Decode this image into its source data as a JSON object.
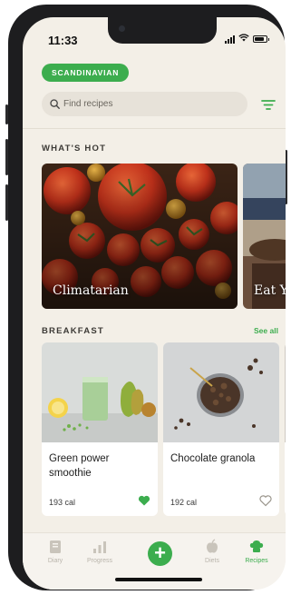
{
  "status": {
    "time": "11:33"
  },
  "header": {
    "region_pill": "SCANDINAVIAN"
  },
  "search": {
    "placeholder": "Find recipes"
  },
  "whats_hot": {
    "heading": "WHAT'S HOT",
    "cards": [
      {
        "label": "Climatarian"
      },
      {
        "label": "Eat Yo"
      }
    ]
  },
  "breakfast": {
    "heading": "BREAKFAST",
    "see_all": "See all",
    "cards": [
      {
        "title": "Green power smoothie",
        "calories": "193 cal",
        "favorited": true
      },
      {
        "title": "Chocolate granola",
        "calories": "192 cal",
        "favorited": false
      }
    ]
  },
  "tabbar": {
    "items": [
      {
        "label": "Diary",
        "icon": "diary-icon",
        "active": false
      },
      {
        "label": "Progress",
        "icon": "progress-icon",
        "active": false
      },
      {
        "label": "",
        "icon": "plus-icon",
        "active": false
      },
      {
        "label": "Diets",
        "icon": "apple-icon",
        "active": false
      },
      {
        "label": "Recipes",
        "icon": "chef-hat-icon",
        "active": true
      }
    ]
  },
  "colors": {
    "accent": "#3cad4e",
    "background": "#f3efe7",
    "search_bg": "#e7e2d9"
  }
}
